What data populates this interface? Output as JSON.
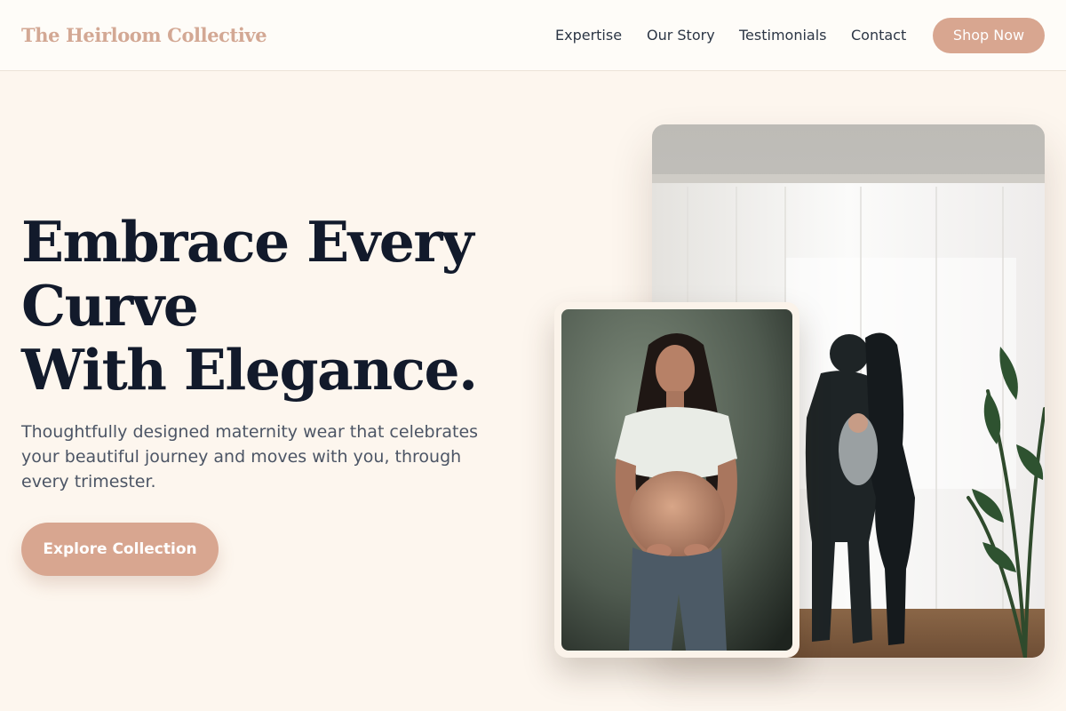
{
  "header": {
    "brand": "The Heirloom Collective",
    "nav": [
      "Expertise",
      "Our Story",
      "Testimonials",
      "Contact"
    ],
    "cta_label": "Shop Now"
  },
  "hero": {
    "title_lines": [
      "Embrace Every",
      "Curve",
      "With Elegance."
    ],
    "subtitle": "Thoughtfully designed maternity wear that celebrates your beautiful journey and moves with you, through every trimester.",
    "cta_label": "Explore Collection"
  },
  "images": {
    "large_alt": "Couple embracing in front of a bright curtained window, man holding newborn",
    "small_alt": "Smiling pregnant woman holding her bare belly"
  },
  "colors": {
    "accent": "#d8a690",
    "brand_text": "#d3a894",
    "heading": "#121a2b",
    "body_text": "#4c5565",
    "background": "#fdf6ee"
  }
}
